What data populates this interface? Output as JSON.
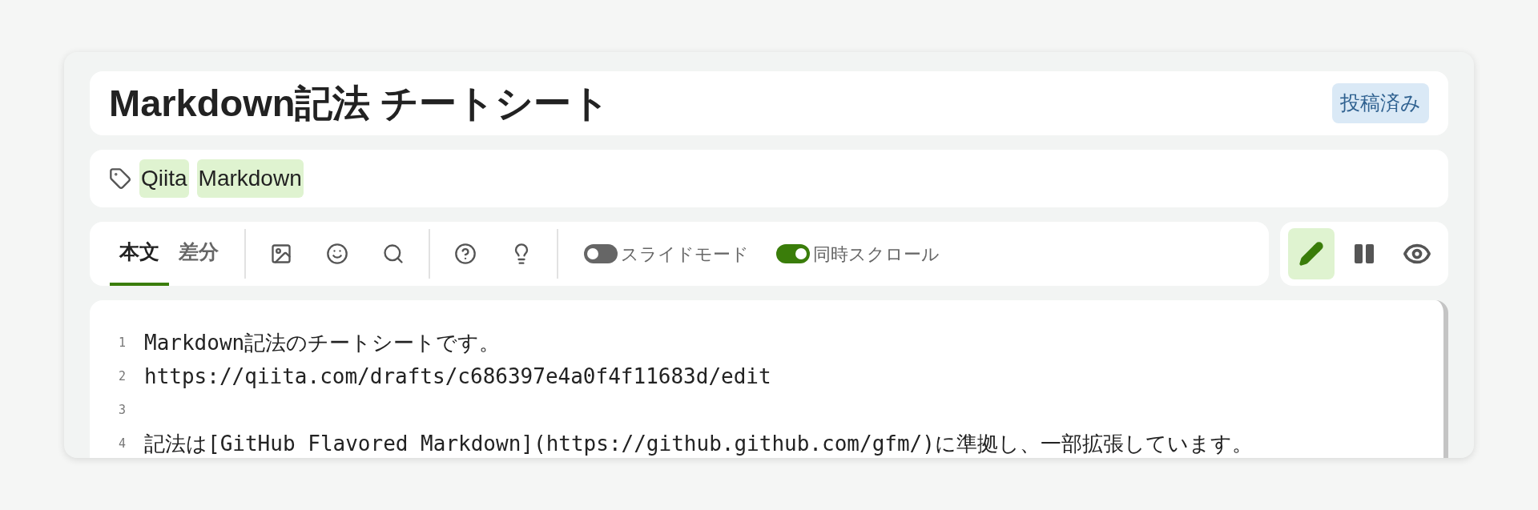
{
  "title": "Markdown記法 チートシート",
  "status_badge": "投稿済み",
  "tags": [
    "Qiita",
    "Markdown"
  ],
  "tabs": [
    {
      "label": "本文",
      "selected": true
    },
    {
      "label": "差分",
      "selected": false
    }
  ],
  "tool_groups": [
    [
      {
        "kind": "image"
      },
      {
        "kind": "emoji"
      },
      {
        "kind": "search"
      }
    ],
    [
      {
        "kind": "help"
      },
      {
        "kind": "tip"
      }
    ]
  ],
  "toggles": [
    {
      "label": "スライドモード",
      "on": false
    },
    {
      "label": "同時スクロール",
      "on": true
    }
  ],
  "view_modes": [
    {
      "kind": "edit",
      "selected": true
    },
    {
      "kind": "split",
      "selected": false
    },
    {
      "kind": "preview",
      "selected": false
    }
  ],
  "editor_lines": [
    {
      "number": "1",
      "text": "Markdown記法のチートシートです。"
    },
    {
      "number": "2",
      "text": "https://qiita.com/drafts/c686397e4a0f4f11683d/edit"
    },
    {
      "number": "3"
    },
    {
      "number": "4",
      "text": "記法は[GitHub Flavored Markdown](https://github.github.com/gfm/)に準拠し、一部拡張しています。"
    }
  ]
}
